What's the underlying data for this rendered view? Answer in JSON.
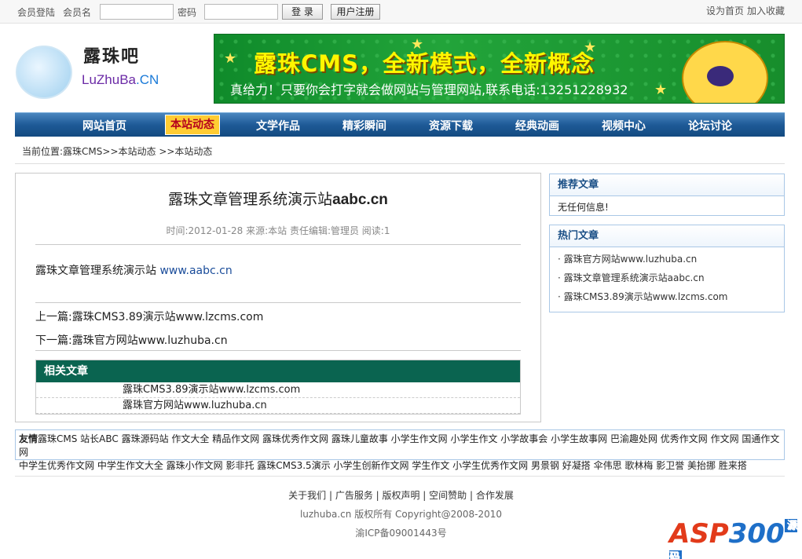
{
  "topbar": {
    "login_label": "会员登陆",
    "username_label": "会员名",
    "username_value": "",
    "password_label": "密码",
    "password_value": "",
    "login_button": "登 录",
    "register_button": "用户注册",
    "set_home": "设为首页",
    "add_favorite": "加入收藏"
  },
  "logo": {
    "cn": "露珠吧",
    "en_a": "LuZhuBa",
    "en_b": ".CN"
  },
  "banner": {
    "title": "露珠CMS，全新模式，全新概念",
    "subtitle": "真给力！只要你会打字就会做网站与管理网站,联系电话:13251228932"
  },
  "nav": {
    "items": [
      "网站首页",
      "本站动态",
      "文学作品",
      "精彩瞬间",
      "资源下载",
      "经典动画",
      "视频中心",
      "论坛讨论"
    ],
    "active": "本站动态"
  },
  "breadcrumb": "当前位置:露珠CMS>>本站动态 >>本站动态",
  "article": {
    "title_cn": "露珠文章管理系统演示站",
    "title_en": "aabc.cn",
    "meta": "时间:2012-01-28 来源:本站 责任编辑:管理员 阅读:1",
    "body_text": "露珠文章管理系统演示站 ",
    "body_link": "www.aabc.cn",
    "prev": "上一篇:露珠CMS3.89演示站www.lzcms.com",
    "next": "下一篇:露珠官方网站www.luzhuba.cn"
  },
  "related": {
    "header": "相关文章",
    "items": [
      "露珠CMS3.89演示站www.lzcms.com",
      "露珠官方网站www.luzhuba.cn"
    ]
  },
  "recommend": {
    "header": "推荐文章",
    "empty": "无任何信息!"
  },
  "hot": {
    "header": "热门文章",
    "items": [
      "· 露珠官方网站www.luzhuba.cn",
      "· 露珠文章管理系统演示站aabc.cn",
      "· 露珠CMS3.89演示站www.lzcms.com"
    ]
  },
  "friend": {
    "label": "友情",
    "line1": "露珠CMS 站长ABC 露珠源码站 作文大全 精品作文网 露珠优秀作文网 露珠儿童故事 小学生作文网 小学生作文 小学故事会 小学生故事网 巴渝趣处网 优秀作文网 作文网 国通作文网",
    "line2": "中学生优秀作文网 中学生作文大全 露珠小作文网 影非托 露珠CMS3.5演示 小学生创新作文网 学生作文 小学生优秀作文网 男景钢 好凝搭 伞伟思 歌林梅 影卫誉 美抬挪 胜来搭"
  },
  "footer": {
    "links": "关于我们 | 广告服务 | 版权声明 | 空间赞助 | 合作发展",
    "copyright": "luzhuba.cn 版权所有 Copyright@2008-2010",
    "icp": "渝ICP备09001443号"
  },
  "watermark": {
    "text_a": "ASP",
    "text_b": "300",
    "tag": "源码"
  }
}
